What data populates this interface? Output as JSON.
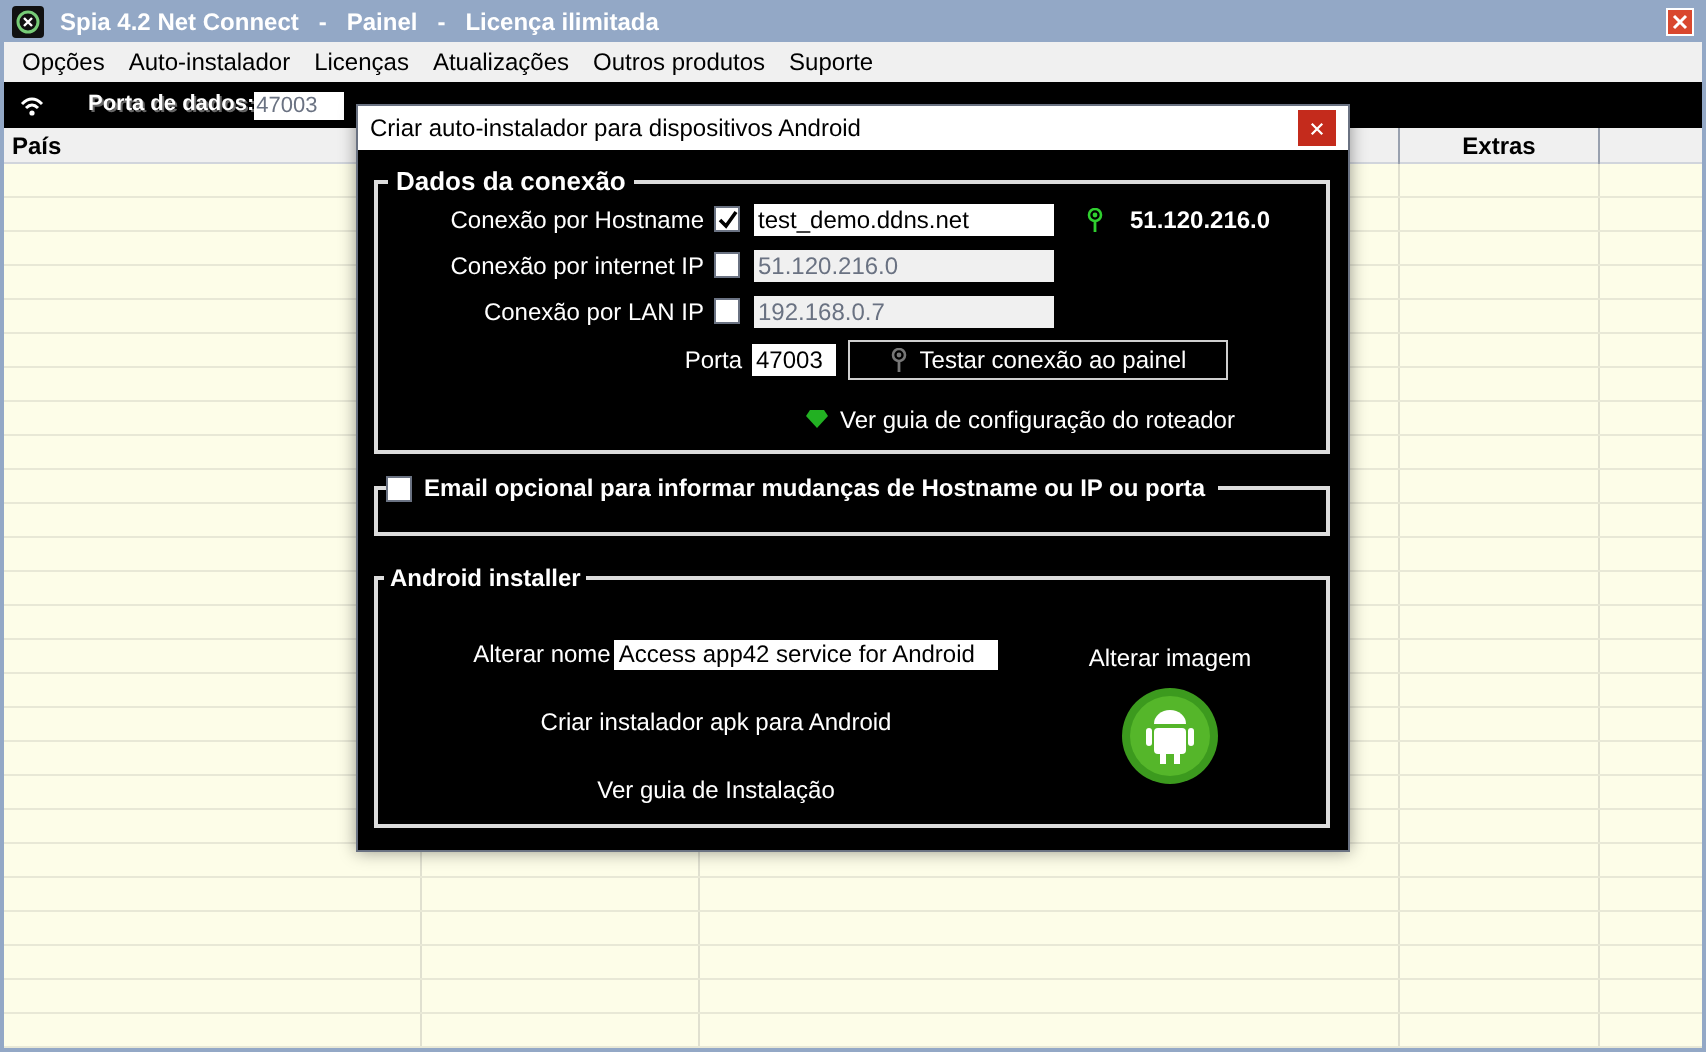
{
  "window": {
    "title": "Spia 4.2 Net Connect   -   Painel   -   Licença ilimitada"
  },
  "menu": [
    {
      "label": "Opções"
    },
    {
      "label": "Auto-instalador"
    },
    {
      "label": "Licenças"
    },
    {
      "label": "Atualizações"
    },
    {
      "label": "Outros produtos"
    },
    {
      "label": "Suporte"
    }
  ],
  "toolbar": {
    "port_label": "Porta de dados:",
    "port_value": "47003"
  },
  "table": {
    "columns": [
      "País",
      "Extras"
    ]
  },
  "dialog": {
    "title": "Criar auto-instalador para dispositivos Android",
    "connection": {
      "title": "Dados da conexão",
      "rows": [
        {
          "label": "Conexão por Hostname",
          "checked": true,
          "value": "test_demo.ddns.net",
          "disabled": false
        },
        {
          "label": "Conexão por internet IP",
          "checked": false,
          "value": "51.120.216.0",
          "disabled": true
        },
        {
          "label": "Conexão por LAN IP",
          "checked": false,
          "value": "192.168.0.7",
          "disabled": true
        }
      ],
      "resolved_ip": "51.120.216.0",
      "port_label": "Porta",
      "port_value": "47003",
      "test_button": "Testar conexão ao painel",
      "router_guide": "Ver guia de configuração do roteador"
    },
    "email": {
      "label": "Email opcional para informar mudanças de Hostname ou IP ou porta",
      "checked": false
    },
    "android": {
      "title": "Android installer",
      "name_label": "Alterar nome",
      "name_value": "Access app42 service for Android",
      "create_apk": "Criar instalador apk para Android",
      "install_guide": "Ver guia de Instalação",
      "change_image": "Alterar imagem"
    }
  }
}
